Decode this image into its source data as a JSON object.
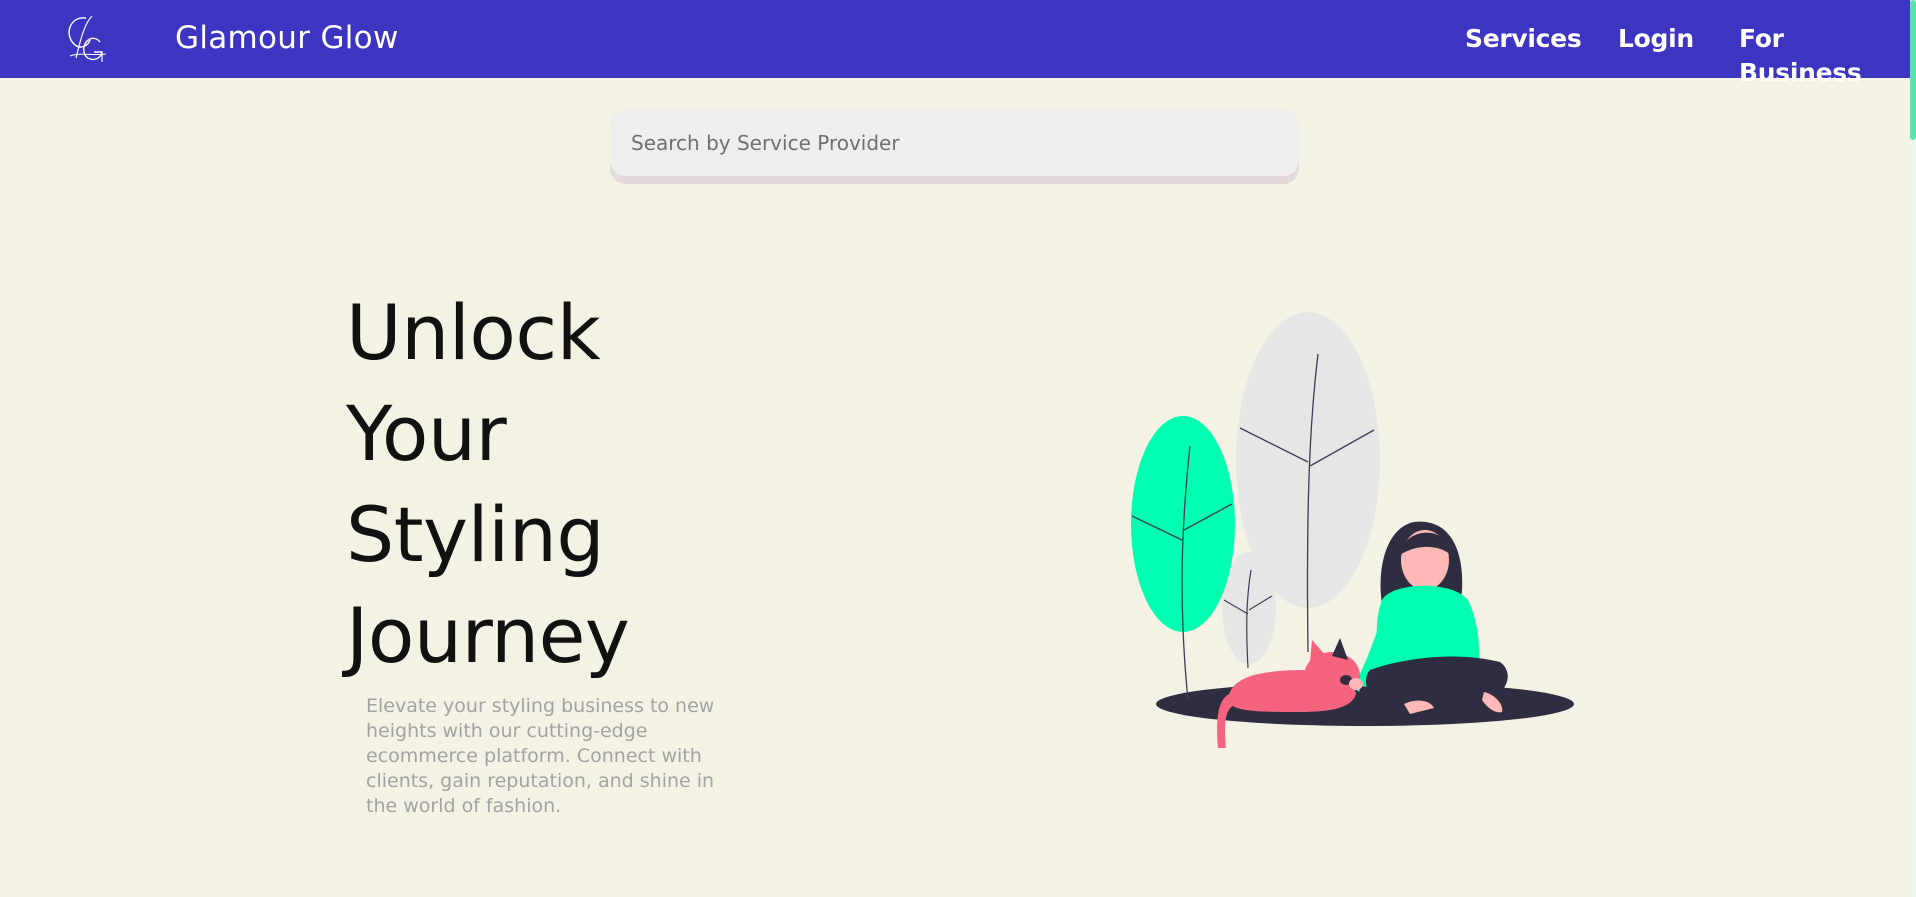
{
  "header": {
    "logo_text": "GG",
    "brand": "Glamour Glow",
    "nav": {
      "services": "Services",
      "login": "Login",
      "for_business": "For Business"
    }
  },
  "search": {
    "placeholder": "Search by Service Provider",
    "value": ""
  },
  "hero": {
    "headline": [
      "Unlock",
      "Your",
      "Styling",
      "Journey"
    ],
    "tagline": "Elevate your styling business to new heights with our cutting-edge ecommerce platform. Connect with clients, gain reputation, and shine in the world of fashion."
  },
  "colors": {
    "navbar": "#3d35c1",
    "background": "#f3f2e4",
    "accent_green": "#00ffb0",
    "cat_pink": "#f5637f",
    "dark": "#2f2e41"
  },
  "icons": {
    "logo": "monogram-logo-icon",
    "illustration": "woman-with-cat-illustration"
  }
}
